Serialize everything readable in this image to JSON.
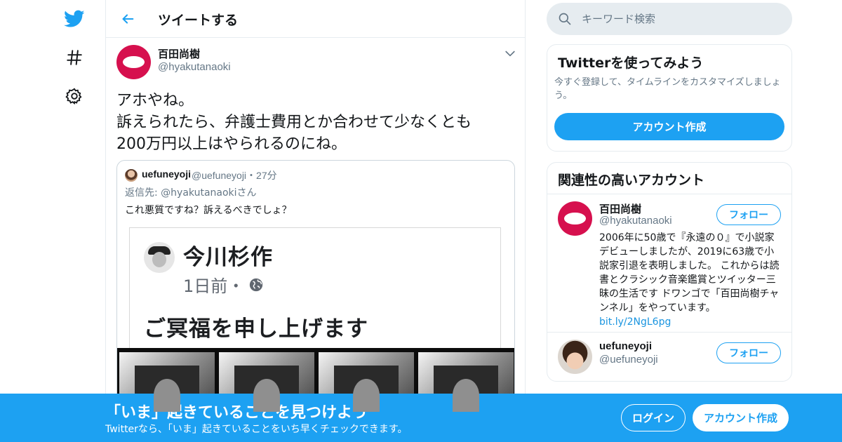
{
  "colors": {
    "brand": "#1da1f2",
    "text": "#14171a",
    "muted": "#657786",
    "border": "#e6ecf0",
    "avatar_ring": "#d6104e"
  },
  "nav": {
    "icons": [
      "twitter-bird-icon",
      "hashtag-icon",
      "gear-icon"
    ]
  },
  "header": {
    "title": "ツイートする"
  },
  "tweet": {
    "author_name": "百田尚樹",
    "author_handle": "@hyakutanaoki",
    "lines": [
      "アホやね。",
      "訴えられたら、弁護士費用とか合わせて少なくとも",
      "200万円以上はやられるのにね。"
    ],
    "quote": {
      "name": "uefuneyoji",
      "handle": "@uefuneyoji",
      "time": "・27分",
      "reply_prefix": "返信先: ",
      "reply_to": "@hyakutanaokiさん",
      "text": "これ悪質ですね？訴えるべきでしょ？",
      "image": {
        "poster_name": "今川杉作",
        "time": "1日前・",
        "post_text": "ご冥福を申し上げます"
      }
    }
  },
  "search": {
    "placeholder": "キーワード検索"
  },
  "signup_card": {
    "title": "Twitterを使ってみよう",
    "subtitle": "今すぐ登録して、タイムラインをカスタマイズしましょう。",
    "button": "アカウント作成"
  },
  "related": {
    "title": "関連性の高いアカウント",
    "accounts": [
      {
        "name": "百田尚樹",
        "handle": "@hyakutanaoki",
        "follow_label": "フォロー",
        "bio": "2006年に50歳で『永遠の０』で小説家デビューしましたが、2019に63歳で小説家引退を表明しました。 これからは読書とクラシック音楽鑑賞とツイッター三昧の生活です ドワンゴで「百田尚樹チャンネル」をやっています。",
        "link": "bit.ly/2NgL6pg"
      },
      {
        "name": "uefuneyoji",
        "handle": "@uefuneyoji",
        "follow_label": "フォロー"
      }
    ]
  },
  "banner": {
    "title": "「いま」起きていることを見つけよう",
    "subtitle": "Twitterなら、「いま」起きていることをいち早くチェックできます。",
    "login": "ログイン",
    "signup": "アカウント作成"
  }
}
